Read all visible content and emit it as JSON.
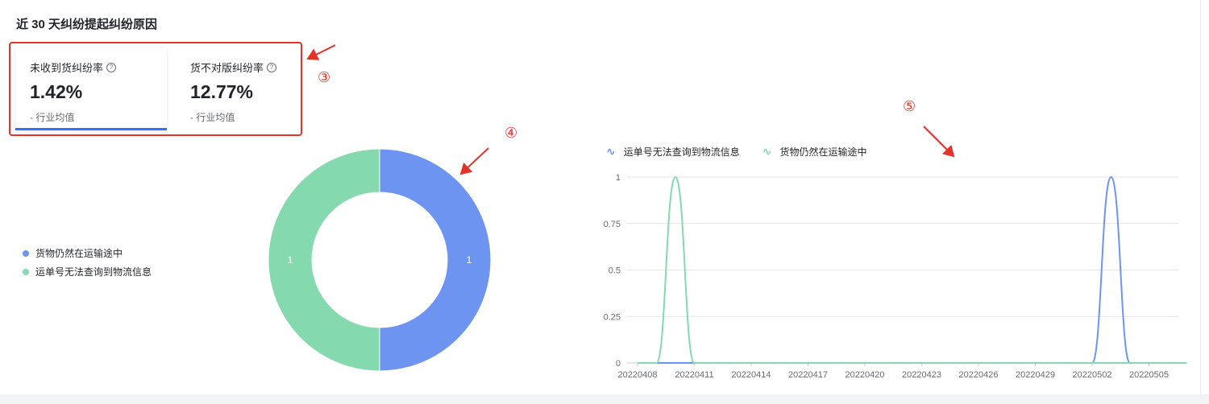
{
  "header": {
    "title": "近 30 天纠纷提起纠纷原因"
  },
  "metrics": [
    {
      "label": "未收到货纠纷率",
      "value": "1.42%",
      "sub": "- 行业均值"
    },
    {
      "label": "货不对版纠纷率",
      "value": "12.77%",
      "sub": "- 行业均值"
    }
  ],
  "annotations": {
    "a3": "③",
    "a4": "④",
    "a5": "⑤"
  },
  "colors": {
    "blue": "#6e94f2",
    "green": "#84d9ae",
    "annotation": "#e5332a",
    "accent": "#3370ff"
  },
  "icons": {
    "help": "question-circle-icon"
  },
  "help_glyph": "?",
  "chart_data": [
    {
      "type": "pie",
      "donut": true,
      "legend_position": "left",
      "legend": [
        "货物仍然在运输途中",
        "运单号无法查询到物流信息"
      ],
      "slices": [
        {
          "name": "货物仍然在运输途中",
          "value": 1,
          "label": "1"
        },
        {
          "name": "运单号无法查询到物流信息",
          "value": 1,
          "label": "1"
        }
      ]
    },
    {
      "type": "line",
      "smooth": true,
      "legend_position": "top-left",
      "x": [
        "20220408",
        "20220409",
        "20220410",
        "20220411",
        "20220412",
        "20220413",
        "20220414",
        "20220415",
        "20220416",
        "20220417",
        "20220418",
        "20220419",
        "20220420",
        "20220421",
        "20220422",
        "20220423",
        "20220424",
        "20220425",
        "20220426",
        "20220427",
        "20220428",
        "20220429",
        "20220430",
        "20220501",
        "20220502",
        "20220503",
        "20220504",
        "20220505",
        "20220506",
        "20220507"
      ],
      "xticks": [
        "20220408",
        "20220411",
        "20220414",
        "20220417",
        "20220420",
        "20220423",
        "20220426",
        "20220429",
        "20220502",
        "20220505"
      ],
      "yticks": [
        "0",
        "0.25",
        "0.5",
        "0.75",
        "1"
      ],
      "ylim": [
        0,
        1
      ],
      "grid": true,
      "series": [
        {
          "name": "运单号无法查询到物流信息",
          "values": [
            0,
            0,
            0,
            0,
            0,
            0,
            0,
            0,
            0,
            0,
            0,
            0,
            0,
            0,
            0,
            0,
            0,
            0,
            0,
            0,
            0,
            0,
            0,
            0,
            0,
            1,
            0,
            0,
            0,
            0
          ]
        },
        {
          "name": "货物仍然在运输途中",
          "values": [
            0,
            0,
            1,
            0,
            0,
            0,
            0,
            0,
            0,
            0,
            0,
            0,
            0,
            0,
            0,
            0,
            0,
            0,
            0,
            0,
            0,
            0,
            0,
            0,
            0,
            0,
            0,
            0,
            0,
            0
          ]
        }
      ]
    }
  ]
}
